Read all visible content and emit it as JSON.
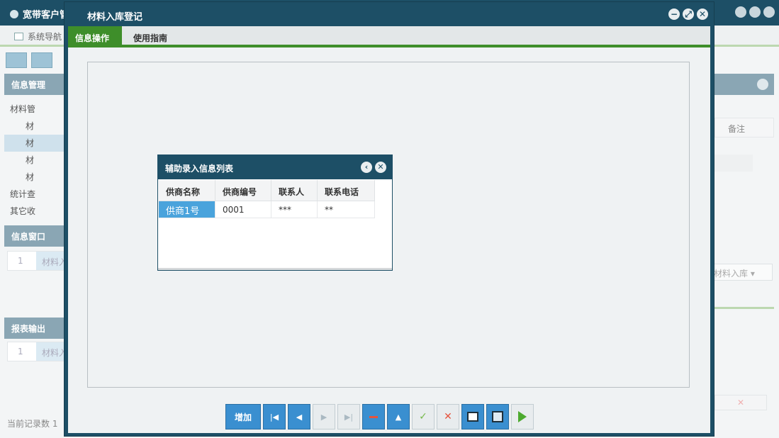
{
  "background": {
    "app_title": "宽带客户管",
    "nav_label": "系统导航",
    "panels": {
      "info_management": "信息管理",
      "info_window": "信息窗口",
      "report_output": "报表输出"
    },
    "tree": [
      "材料管",
      "材",
      "材",
      "材",
      "材",
      "统计查",
      "其它收"
    ],
    "info_window_row": {
      "index": "1",
      "text": "材料入"
    },
    "report_row": {
      "index": "1",
      "text": "材料入"
    },
    "status": "当前记录数 1",
    "right_column_header": "备注",
    "right_select_value": "材料入库"
  },
  "dialog": {
    "title": "材料入库登记",
    "controls": {
      "minimize": "−",
      "restore": "⤢",
      "close": "✕"
    },
    "tabs": [
      {
        "label": "信息操作",
        "active": true
      },
      {
        "label": "使用指南",
        "active": false
      }
    ]
  },
  "lookup": {
    "title": "辅助录入信息列表",
    "controls": {
      "back": "‹",
      "close": "✕"
    },
    "columns": [
      "供商名称",
      "供商编号",
      "联系人",
      "联系电话"
    ],
    "rows": [
      [
        "供商1号",
        "0001",
        "***",
        "**"
      ]
    ]
  },
  "toolbar": {
    "add_label": "增加",
    "buttons": [
      "first-record",
      "prev-record",
      "next-record",
      "last-record",
      "delete-record",
      "move-up",
      "confirm",
      "cancel",
      "print",
      "print-preview",
      "run"
    ]
  },
  "colors": {
    "titlebar": "#1d4f66",
    "tab_active": "#3e8e2a",
    "toolbar_blue": "#3a8fd0",
    "selected_cell": "#4aa3dc"
  }
}
